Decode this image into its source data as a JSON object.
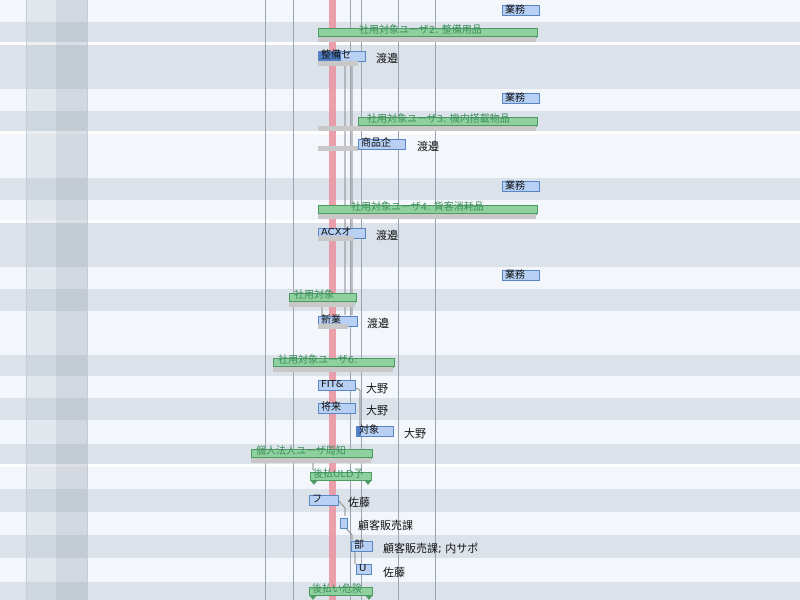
{
  "colors": {
    "summary": "#8fd19e",
    "task": "#b7d0f3",
    "progress": "#4f7fc7",
    "today": "#e99aa6",
    "alt_row": "#dbe2ea"
  },
  "groups": [
    {
      "tag": "業務",
      "summary": "社用対象ユーザ2: 整備用品",
      "task": "整備セ",
      "resource": "渡邉"
    },
    {
      "tag": "業務",
      "summary": "社用対象ユーザ3: 機内搭載物品",
      "task": "商品企",
      "resource": "渡邉"
    },
    {
      "tag": "業務",
      "summary": "社用対象ユーザ4: 貨客消耗品",
      "task": "ACXオ",
      "resource": "渡邉"
    },
    {
      "tag": "業務",
      "summary": "社用対象",
      "task": "新業",
      "resource": "渡邉"
    }
  ],
  "group6": {
    "summary": "社用対象ユーザ6:",
    "tasks": [
      {
        "label": "FIT&",
        "resource": "大野"
      },
      {
        "label": "将来",
        "resource": "大野"
      },
      {
        "label": "対象",
        "resource": "大野"
      }
    ]
  },
  "group7": {
    "summary": "個人法人ユーザ周知",
    "sub_summary": "後払ULD予",
    "tasks": [
      {
        "label": "フ",
        "resource": "佐藤"
      },
      {
        "label": "",
        "resource": "顧客販売課"
      },
      {
        "label": "部",
        "resource": "顧客販売課; 内サポ"
      },
      {
        "label": "U",
        "resource": "佐藤"
      }
    ],
    "last_summary": "後払い危険"
  }
}
